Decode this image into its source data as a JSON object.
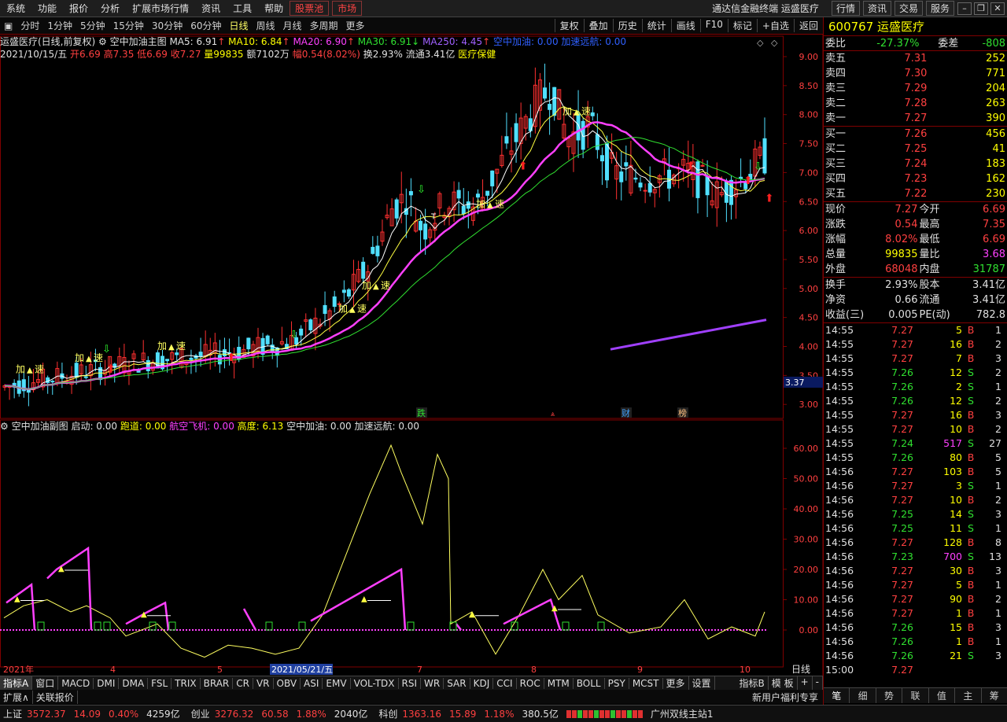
{
  "menu": {
    "items": [
      "系统",
      "功能",
      "报价",
      "分析",
      "扩展市场行情",
      "资讯",
      "工具",
      "帮助"
    ],
    "stock_pool": "股票池",
    "market": "市场",
    "title": "通达信金融终端  运盛医疗",
    "top_buttons": [
      "行情",
      "资讯",
      "交易",
      "服务"
    ]
  },
  "toolbar": {
    "periods": [
      "分时",
      "1分钟",
      "5分钟",
      "15分钟",
      "30分钟",
      "60分钟",
      "日线",
      "周线",
      "月线",
      "多周期",
      "更多"
    ],
    "active": "日线",
    "right": [
      "复权",
      "叠加",
      "历史",
      "统计",
      "画线",
      "F10",
      "标记",
      "+自选",
      "返回"
    ]
  },
  "chart": {
    "line1": {
      "name": "运盛医疗(日线,前复权)",
      "main_ind": "空中加油主图",
      "ma5": "MA5: 6.91",
      "ma10": "MA10: 6.84",
      "ma20": "MA20: 6.90",
      "ma30": "MA30: 6.91",
      "ma250": "MA250: 4.45",
      "kz": "空中加油: 0.00",
      "jsyh": "加速远航: 0.00"
    },
    "line2": {
      "date": "2021/10/15/五",
      "open": "开6.69",
      "high": "高7.35",
      "low": "低6.69",
      "close": "收7.27",
      "vol": "量99835",
      "amt": "额7102万",
      "chg": "幅0.54(8.02%)",
      "turn": "换2.93%",
      "float": "流通3.41亿",
      "sector": "医疗保健"
    },
    "price_ticks": [
      "9.00",
      "8.50",
      "8.00",
      "7.50",
      "7.00",
      "6.50",
      "6.00",
      "5.50",
      "5.00",
      "4.50",
      "4.00",
      "3.50",
      "3.00"
    ],
    "cursor_price": "3.37",
    "signal_labels": {
      "jia": "加",
      "su": "速",
      "t": "T"
    },
    "event_labels": [
      "跌",
      "财",
      "榜"
    ],
    "sub_info": {
      "name": "空中加油副图",
      "qd": "启动: 0.00",
      "pd": "跑道: 0.00",
      "hk": "航空飞机: 0.00",
      "gd": "高度: 6.13",
      "kz": "空中加油: 0.00",
      "js": "加速远航: 0.00"
    },
    "sub_ticks": [
      "60.00",
      "50.00",
      "40.00",
      "30.00",
      "20.00",
      "10.00",
      "0.00"
    ],
    "date_axis": [
      "2021年",
      "4",
      "5",
      "2021/05/21/五",
      "7",
      "8",
      "9",
      "10"
    ],
    "period_btn": "日线"
  },
  "bottom_tabs": [
    "指标A",
    "窗口",
    "MACD",
    "DMI",
    "DMA",
    "FSL",
    "TRIX",
    "BRAR",
    "CR",
    "VR",
    "OBV",
    "ASI",
    "EMV",
    "VOL-TDX",
    "RSI",
    "WR",
    "SAR",
    "KDJ",
    "CCI",
    "ROC",
    "MTM",
    "BOLL",
    "PSY",
    "MCST",
    "更多",
    "设置"
  ],
  "bottom_right": [
    "指标B",
    "模 板",
    "+",
    "-"
  ],
  "expand": [
    "扩展∧",
    "关联报价"
  ],
  "quote": {
    "code": "600767",
    "name": "运盛医疗",
    "wb": {
      "label": "委比",
      "value": "-27.37%",
      "label2": "委差",
      "value2": "-808"
    },
    "sells": [
      {
        "l": "卖五",
        "p": "7.31",
        "v": "252"
      },
      {
        "l": "卖四",
        "p": "7.30",
        "v": "771"
      },
      {
        "l": "卖三",
        "p": "7.29",
        "v": "204"
      },
      {
        "l": "卖二",
        "p": "7.28",
        "v": "263"
      },
      {
        "l": "卖一",
        "p": "7.27",
        "v": "390"
      }
    ],
    "buys": [
      {
        "l": "买一",
        "p": "7.26",
        "v": "456"
      },
      {
        "l": "买二",
        "p": "7.25",
        "v": "41"
      },
      {
        "l": "买三",
        "p": "7.24",
        "v": "183"
      },
      {
        "l": "买四",
        "p": "7.23",
        "v": "162"
      },
      {
        "l": "买五",
        "p": "7.22",
        "v": "230"
      }
    ],
    "stats": [
      {
        "a": "现价",
        "av": "7.27",
        "b": "今开",
        "bv": "6.69"
      },
      {
        "a": "涨跌",
        "av": "0.54",
        "b": "最高",
        "bv": "7.35"
      },
      {
        "a": "涨幅",
        "av": "8.02%",
        "b": "最低",
        "bv": "6.69"
      },
      {
        "a": "总量",
        "av": "99835",
        "b": "量比",
        "bv": "3.68"
      },
      {
        "a": "外盘",
        "av": "68048",
        "b": "内盘",
        "bv": "31787"
      }
    ],
    "stats2": [
      {
        "a": "换手",
        "av": "2.93%",
        "b": "股本",
        "bv": "3.41亿"
      },
      {
        "a": "净资",
        "av": "0.66",
        "b": "流通",
        "bv": "3.41亿"
      },
      {
        "a": "收益(三)",
        "av": "0.005",
        "b": "PE(动)",
        "bv": "782.8"
      }
    ],
    "ticks": [
      [
        "14:55",
        "7.27",
        "5",
        "B",
        "1"
      ],
      [
        "14:55",
        "7.27",
        "16",
        "B",
        "2"
      ],
      [
        "14:55",
        "7.27",
        "7",
        "B",
        "3"
      ],
      [
        "14:55",
        "7.26",
        "12",
        "S",
        "2"
      ],
      [
        "14:55",
        "7.26",
        "2",
        "S",
        "1"
      ],
      [
        "14:55",
        "7.26",
        "12",
        "S",
        "2"
      ],
      [
        "14:55",
        "7.27",
        "16",
        "B",
        "3"
      ],
      [
        "14:55",
        "7.27",
        "10",
        "B",
        "2"
      ],
      [
        "14:55",
        "7.24",
        "517",
        "S",
        "27"
      ],
      [
        "14:55",
        "7.26",
        "80",
        "B",
        "5"
      ],
      [
        "14:56",
        "7.27",
        "103",
        "B",
        "5"
      ],
      [
        "14:56",
        "7.27",
        "3",
        "S",
        "1"
      ],
      [
        "14:56",
        "7.27",
        "10",
        "B",
        "2"
      ],
      [
        "14:56",
        "7.25",
        "14",
        "S",
        "3"
      ],
      [
        "14:56",
        "7.25",
        "11",
        "S",
        "1"
      ],
      [
        "14:56",
        "7.27",
        "128",
        "B",
        "8"
      ],
      [
        "14:56",
        "7.23",
        "700",
        "S",
        "13"
      ],
      [
        "14:56",
        "7.27",
        "30",
        "B",
        "3"
      ],
      [
        "14:56",
        "7.27",
        "5",
        "B",
        "1"
      ],
      [
        "14:56",
        "7.27",
        "90",
        "B",
        "2"
      ],
      [
        "14:56",
        "7.27",
        "1",
        "B",
        "1"
      ],
      [
        "14:56",
        "7.26",
        "15",
        "B",
        "3"
      ],
      [
        "14:56",
        "7.26",
        "1",
        "B",
        "1"
      ],
      [
        "14:56",
        "7.26",
        "21",
        "S",
        "3"
      ],
      [
        "15:00",
        "7.27",
        "",
        "",
        ""
      ]
    ],
    "tabs": [
      "笔",
      "细",
      "势",
      "联",
      "值",
      "主",
      "筹"
    ]
  },
  "status": [
    {
      "n": "上证",
      "v": "3572.37",
      "c": "14.09",
      "p": "0.40%",
      "a": "4259亿"
    },
    {
      "n": "创业",
      "v": "3276.32",
      "c": "60.58",
      "p": "1.88%",
      "a": "2040亿"
    },
    {
      "n": "科创",
      "v": "1363.16",
      "c": "15.89",
      "p": "1.18%",
      "a": "380.5亿"
    }
  ],
  "status_server": "广州双线主站1",
  "promo": "新用户福利专享"
}
